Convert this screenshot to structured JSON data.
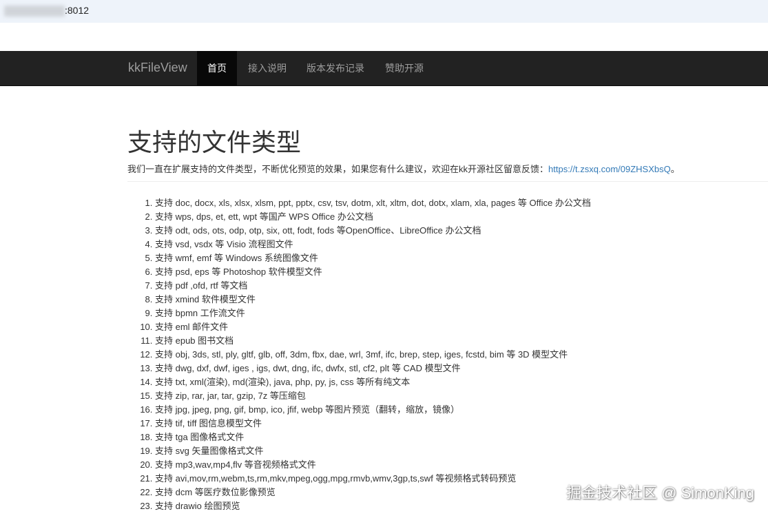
{
  "address_bar": {
    "url_text": ":8012"
  },
  "navbar": {
    "brand": "kkFileView",
    "items": [
      {
        "label": "首页",
        "active": true
      },
      {
        "label": "接入说明",
        "active": false
      },
      {
        "label": "版本发布记录",
        "active": false
      },
      {
        "label": "赞助开源",
        "active": false
      }
    ]
  },
  "main": {
    "title": "支持的文件类型",
    "intro_text": "我们一直在扩展支持的文件类型，不断优化预览的效果，如果您有什么建议，欢迎在kk开源社区留意反馈：",
    "intro_link": "https://t.zsxq.com/09ZHSXbsQ",
    "intro_suffix": "。",
    "file_types": [
      "支持 doc, docx, xls, xlsx, xlsm, ppt, pptx, csv, tsv, dotm, xlt, xltm, dot, dotx, xlam, xla, pages 等 Office 办公文档",
      "支持 wps, dps, et, ett, wpt 等国产 WPS Office 办公文档",
      "支持 odt, ods, ots, odp, otp, six, ott, fodt, fods 等OpenOffice、LibreOffice 办公文档",
      "支持 vsd, vsdx 等 Visio 流程图文件",
      "支持 wmf, emf 等 Windows 系统图像文件",
      "支持 psd, eps 等 Photoshop 软件模型文件",
      "支持 pdf ,ofd, rtf 等文档",
      "支持 xmind 软件模型文件",
      "支持 bpmn 工作流文件",
      "支持 eml 邮件文件",
      "支持 epub 图书文档",
      "支持 obj, 3ds, stl, ply, gltf, glb, off, 3dm, fbx, dae, wrl, 3mf, ifc, brep, step, iges, fcstd, bim 等 3D 模型文件",
      "支持 dwg, dxf, dwf, iges , igs, dwt, dng, ifc, dwfx, stl, cf2, plt 等 CAD 模型文件",
      "支持 txt, xml(渲染), md(渲染), java, php, py, js, css 等所有纯文本",
      "支持 zip, rar, jar, tar, gzip, 7z 等压缩包",
      "支持 jpg, jpeg, png, gif, bmp, ico, jfif, webp 等图片预览（翻转，缩放，镜像）",
      "支持 tif, tiff 图信息模型文件",
      "支持 tga 图像格式文件",
      "支持 svg 矢量图像格式文件",
      "支持 mp3,wav,mp4,flv 等音视频格式文件",
      "支持 avi,mov,rm,webm,ts,rm,mkv,mpeg,ogg,mpg,rmvb,wmv,3gp,ts,swf 等视频格式转码预览",
      "支持 dcm 等医疗数位影像预览",
      "支持 drawio 绘图预览"
    ]
  },
  "watermark": "掘金技术社区 @ SimonKing"
}
